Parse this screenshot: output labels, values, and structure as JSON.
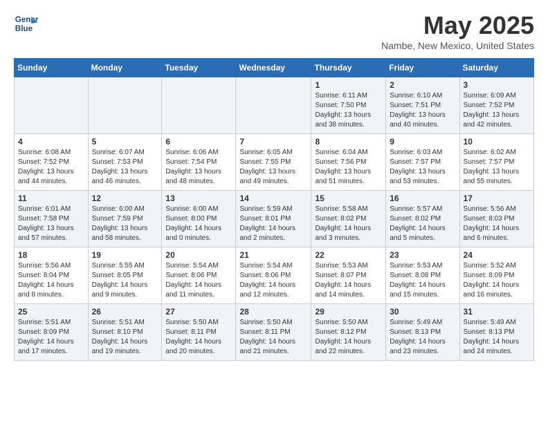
{
  "header": {
    "logo_line1": "General",
    "logo_line2": "Blue",
    "month_title": "May 2025",
    "location": "Nambe, New Mexico, United States"
  },
  "weekdays": [
    "Sunday",
    "Monday",
    "Tuesday",
    "Wednesday",
    "Thursday",
    "Friday",
    "Saturday"
  ],
  "weeks": [
    [
      {
        "day": "",
        "info": ""
      },
      {
        "day": "",
        "info": ""
      },
      {
        "day": "",
        "info": ""
      },
      {
        "day": "",
        "info": ""
      },
      {
        "day": "1",
        "info": "Sunrise: 6:11 AM\nSunset: 7:50 PM\nDaylight: 13 hours\nand 38 minutes."
      },
      {
        "day": "2",
        "info": "Sunrise: 6:10 AM\nSunset: 7:51 PM\nDaylight: 13 hours\nand 40 minutes."
      },
      {
        "day": "3",
        "info": "Sunrise: 6:09 AM\nSunset: 7:52 PM\nDaylight: 13 hours\nand 42 minutes."
      }
    ],
    [
      {
        "day": "4",
        "info": "Sunrise: 6:08 AM\nSunset: 7:52 PM\nDaylight: 13 hours\nand 44 minutes."
      },
      {
        "day": "5",
        "info": "Sunrise: 6:07 AM\nSunset: 7:53 PM\nDaylight: 13 hours\nand 46 minutes."
      },
      {
        "day": "6",
        "info": "Sunrise: 6:06 AM\nSunset: 7:54 PM\nDaylight: 13 hours\nand 48 minutes."
      },
      {
        "day": "7",
        "info": "Sunrise: 6:05 AM\nSunset: 7:55 PM\nDaylight: 13 hours\nand 49 minutes."
      },
      {
        "day": "8",
        "info": "Sunrise: 6:04 AM\nSunset: 7:56 PM\nDaylight: 13 hours\nand 51 minutes."
      },
      {
        "day": "9",
        "info": "Sunrise: 6:03 AM\nSunset: 7:57 PM\nDaylight: 13 hours\nand 53 minutes."
      },
      {
        "day": "10",
        "info": "Sunrise: 6:02 AM\nSunset: 7:57 PM\nDaylight: 13 hours\nand 55 minutes."
      }
    ],
    [
      {
        "day": "11",
        "info": "Sunrise: 6:01 AM\nSunset: 7:58 PM\nDaylight: 13 hours\nand 57 minutes."
      },
      {
        "day": "12",
        "info": "Sunrise: 6:00 AM\nSunset: 7:59 PM\nDaylight: 13 hours\nand 58 minutes."
      },
      {
        "day": "13",
        "info": "Sunrise: 6:00 AM\nSunset: 8:00 PM\nDaylight: 14 hours\nand 0 minutes."
      },
      {
        "day": "14",
        "info": "Sunrise: 5:59 AM\nSunset: 8:01 PM\nDaylight: 14 hours\nand 2 minutes."
      },
      {
        "day": "15",
        "info": "Sunrise: 5:58 AM\nSunset: 8:02 PM\nDaylight: 14 hours\nand 3 minutes."
      },
      {
        "day": "16",
        "info": "Sunrise: 5:57 AM\nSunset: 8:02 PM\nDaylight: 14 hours\nand 5 minutes."
      },
      {
        "day": "17",
        "info": "Sunrise: 5:56 AM\nSunset: 8:03 PM\nDaylight: 14 hours\nand 6 minutes."
      }
    ],
    [
      {
        "day": "18",
        "info": "Sunrise: 5:56 AM\nSunset: 8:04 PM\nDaylight: 14 hours\nand 8 minutes."
      },
      {
        "day": "19",
        "info": "Sunrise: 5:55 AM\nSunset: 8:05 PM\nDaylight: 14 hours\nand 9 minutes."
      },
      {
        "day": "20",
        "info": "Sunrise: 5:54 AM\nSunset: 8:06 PM\nDaylight: 14 hours\nand 11 minutes."
      },
      {
        "day": "21",
        "info": "Sunrise: 5:54 AM\nSunset: 8:06 PM\nDaylight: 14 hours\nand 12 minutes."
      },
      {
        "day": "22",
        "info": "Sunrise: 5:53 AM\nSunset: 8:07 PM\nDaylight: 14 hours\nand 14 minutes."
      },
      {
        "day": "23",
        "info": "Sunrise: 5:53 AM\nSunset: 8:08 PM\nDaylight: 14 hours\nand 15 minutes."
      },
      {
        "day": "24",
        "info": "Sunrise: 5:52 AM\nSunset: 8:09 PM\nDaylight: 14 hours\nand 16 minutes."
      }
    ],
    [
      {
        "day": "25",
        "info": "Sunrise: 5:51 AM\nSunset: 8:09 PM\nDaylight: 14 hours\nand 17 minutes."
      },
      {
        "day": "26",
        "info": "Sunrise: 5:51 AM\nSunset: 8:10 PM\nDaylight: 14 hours\nand 19 minutes."
      },
      {
        "day": "27",
        "info": "Sunrise: 5:50 AM\nSunset: 8:11 PM\nDaylight: 14 hours\nand 20 minutes."
      },
      {
        "day": "28",
        "info": "Sunrise: 5:50 AM\nSunset: 8:11 PM\nDaylight: 14 hours\nand 21 minutes."
      },
      {
        "day": "29",
        "info": "Sunrise: 5:50 AM\nSunset: 8:12 PM\nDaylight: 14 hours\nand 22 minutes."
      },
      {
        "day": "30",
        "info": "Sunrise: 5:49 AM\nSunset: 8:13 PM\nDaylight: 14 hours\nand 23 minutes."
      },
      {
        "day": "31",
        "info": "Sunrise: 5:49 AM\nSunset: 8:13 PM\nDaylight: 14 hours\nand 24 minutes."
      }
    ]
  ]
}
